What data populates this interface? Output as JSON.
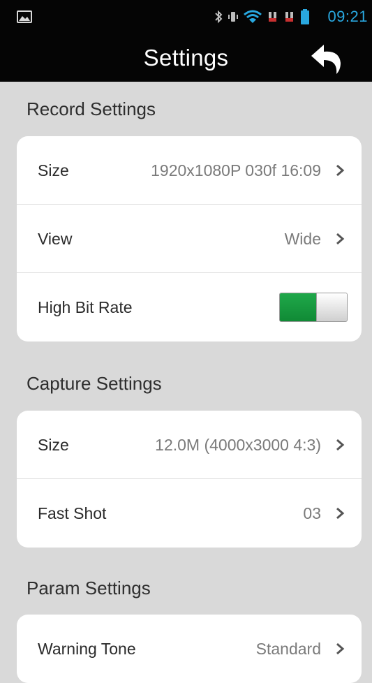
{
  "status_bar": {
    "time": "09:21",
    "icons": [
      "gallery-icon",
      "bluetooth-icon",
      "vibrate-icon",
      "wifi-icon",
      "signal-icon",
      "signal-icon",
      "battery-icon"
    ],
    "clock_color": "#29a8e0"
  },
  "header": {
    "title": "Settings",
    "back_icon": "back-arrow-icon"
  },
  "record": {
    "heading": "Record Settings",
    "size": {
      "label": "Size",
      "value": "1920x1080P 030f 16:09"
    },
    "view": {
      "label": "View",
      "value": "Wide"
    },
    "high_bit_rate": {
      "label": "High Bit Rate",
      "on": true
    }
  },
  "capture": {
    "heading": "Capture Settings",
    "size": {
      "label": "Size",
      "value": "12.0M (4000x3000 4:3)"
    },
    "fast_shot": {
      "label": "Fast Shot",
      "value": "03"
    }
  },
  "param": {
    "heading": "Param Settings",
    "warning_tone": {
      "label": "Warning Tone",
      "value": "Standard"
    }
  },
  "colors": {
    "toggle_on": "#1a9a40",
    "background": "#d9d9d9",
    "header": "#050505"
  }
}
